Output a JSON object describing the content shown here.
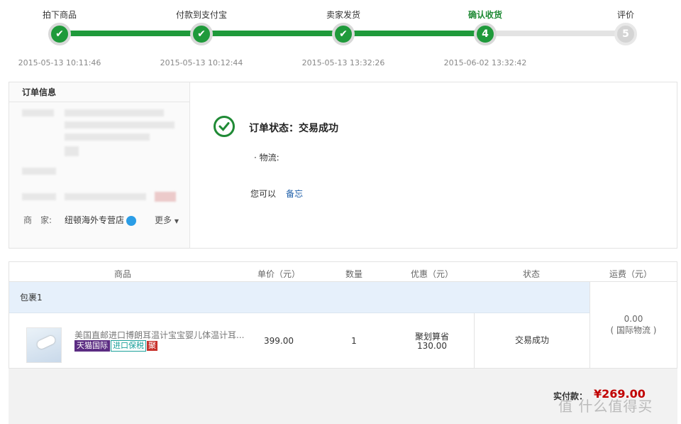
{
  "steps": [
    {
      "name": "拍下商品",
      "time": "2015-05-13 10:11:46",
      "state": "done",
      "mark": "✔"
    },
    {
      "name": "付款到支付宝",
      "time": "2015-05-13 10:12:44",
      "state": "done",
      "mark": "✔"
    },
    {
      "name": "卖家发货",
      "time": "2015-05-13 13:32:26",
      "state": "done",
      "mark": "✔"
    },
    {
      "name": "确认收货",
      "time": "2015-06-02 13:32:42",
      "state": "cur",
      "mark": "4"
    },
    {
      "name": "评价",
      "time": "",
      "state": "todo",
      "mark": "5"
    }
  ],
  "order_info": {
    "title": "订单信息",
    "merchant_label": "商　家:",
    "merchant_name": "纽顿海外专营店",
    "more": "更多"
  },
  "status": {
    "text": "订单状态：交易成功",
    "logistics": "· 物流:",
    "you_can": "您可以",
    "memo": "备忘"
  },
  "table": {
    "headers": {
      "item": "商品",
      "price": "单价（元）",
      "qty": "数量",
      "discount": "优惠（元）",
      "status": "状态",
      "shipping": "运费（元）"
    },
    "package": "包裹1",
    "row": {
      "name": "美国直邮进口博朗耳温计宝宝婴儿体温计耳...",
      "tag1": "天猫国际",
      "tag2": "进口保税",
      "tag3": "聚",
      "price": "399.00",
      "qty": "1",
      "discount_label": "聚划算省",
      "discount_value": "130.00",
      "status": "交易成功"
    },
    "shipping_value": "0.00",
    "shipping_note": "( 国际物流 )"
  },
  "footer": {
    "total_label": "实付款：",
    "total": "¥269.00"
  },
  "watermark": "值 什么值得买",
  "colors": {
    "green": "#1f9a3b",
    "price_red": "#c10000",
    "link_blue": "#1d5ea8"
  }
}
